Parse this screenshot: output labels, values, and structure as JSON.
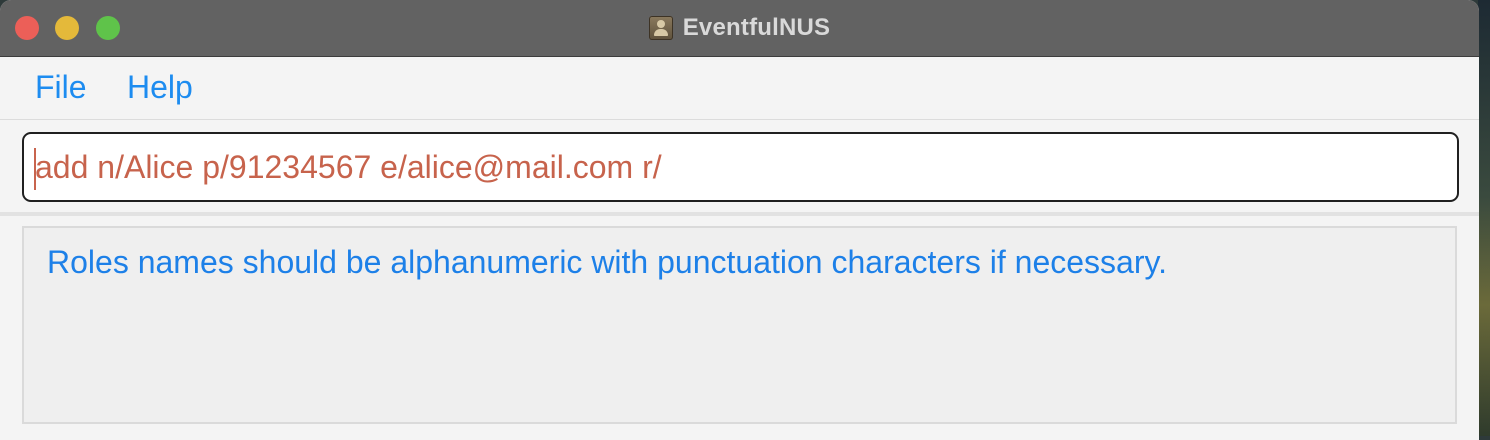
{
  "window": {
    "title": "EventfulNUS",
    "app_icon": "contacts-app-icon"
  },
  "menubar": {
    "items": [
      {
        "label": "File"
      },
      {
        "label": "Help"
      }
    ]
  },
  "command": {
    "value": "add n/Alice p/91234567 e/alice@mail.com r/"
  },
  "result": {
    "message": "Roles names should be alphanumeric with punctuation characters if necessary."
  },
  "colors": {
    "titlebar": "#626262",
    "menu_text": "#1d8cf0",
    "command_error_text": "#c7634c",
    "result_text": "#1d80e8",
    "close": "#ec5f58",
    "minimize": "#e4b93a",
    "zoom": "#5fc34a"
  }
}
